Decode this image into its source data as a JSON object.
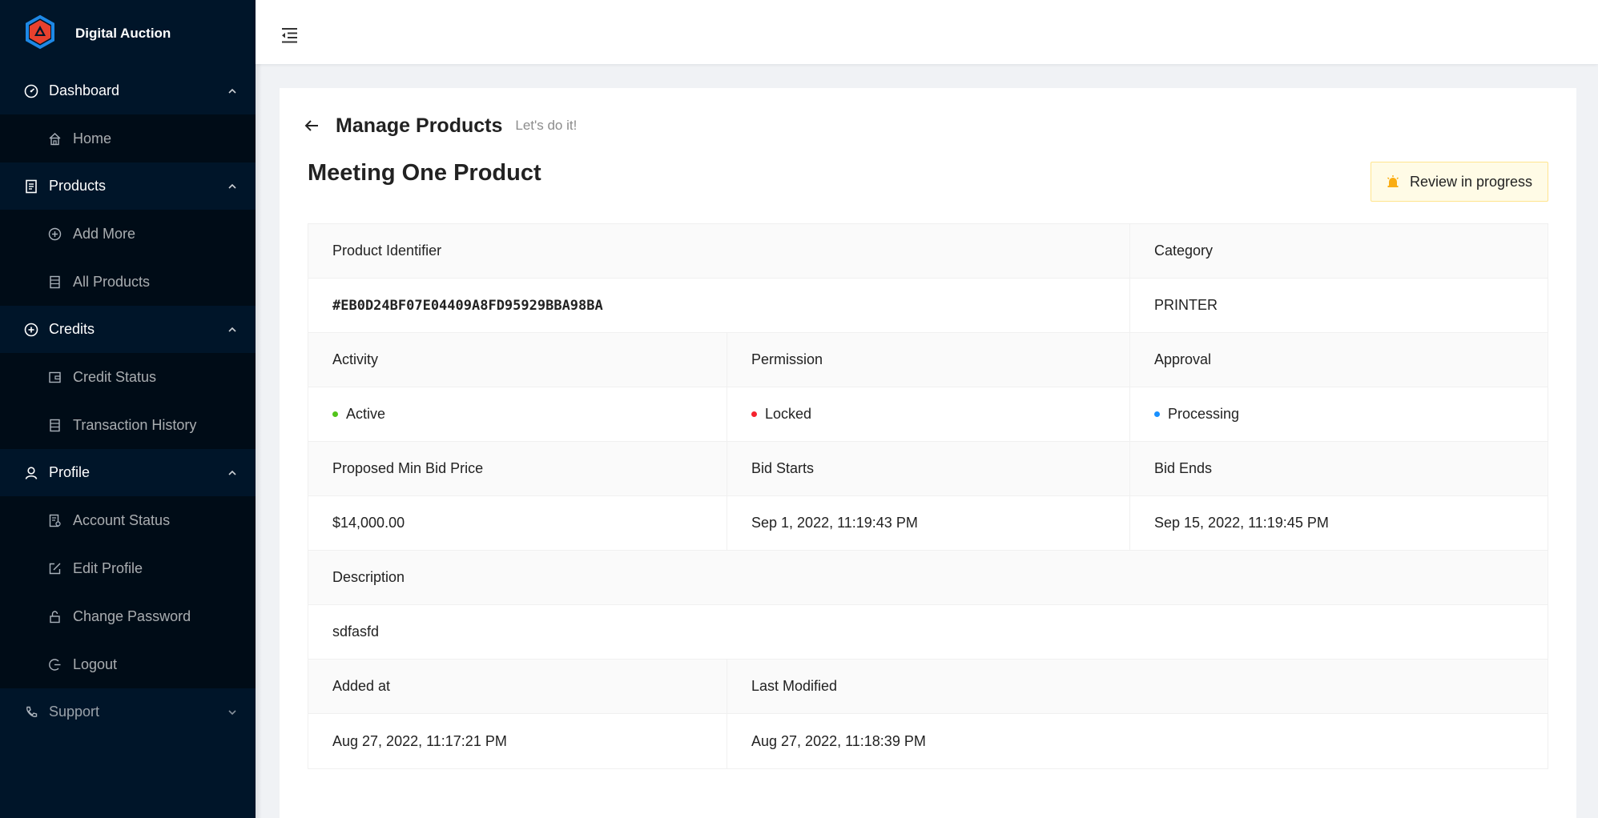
{
  "brand": {
    "name": "Digital Auction"
  },
  "colors": {
    "sidebar_bg": "#001529",
    "submenu_bg": "#000c17",
    "brand_red": "#e8412e",
    "brand_blue": "#1e88e5",
    "active": "#52c41a",
    "locked": "#f5222d",
    "processing": "#1890ff",
    "warning_bg": "#fffbe6",
    "warning_icon": "#faad14"
  },
  "sidebar": {
    "groups": [
      {
        "label": "Dashboard",
        "icon": "dashboard-icon",
        "items": [
          {
            "label": "Home",
            "icon": "home-icon"
          }
        ]
      },
      {
        "label": "Products",
        "icon": "file-text-icon",
        "items": [
          {
            "label": "Add More",
            "icon": "plus-circle-icon"
          },
          {
            "label": "All Products",
            "icon": "database-icon"
          }
        ]
      },
      {
        "label": "Credits",
        "icon": "plus-circle-icon",
        "items": [
          {
            "label": "Credit Status",
            "icon": "wallet-icon"
          },
          {
            "label": "Transaction History",
            "icon": "database-icon"
          }
        ]
      },
      {
        "label": "Profile",
        "icon": "user-icon",
        "items": [
          {
            "label": "Account Status",
            "icon": "solution-icon"
          },
          {
            "label": "Edit Profile",
            "icon": "edit-icon"
          },
          {
            "label": "Change Password",
            "icon": "unlock-icon"
          },
          {
            "label": "Logout",
            "icon": "logout-icon"
          }
        ]
      },
      {
        "label": "Support",
        "icon": "phone-icon",
        "items": []
      }
    ]
  },
  "page": {
    "title": "Manage Products",
    "subtitle": "Let's do it!"
  },
  "product": {
    "name": "Meeting One Product",
    "status_tag": "Review in progress",
    "labels": {
      "identifier": "Product Identifier",
      "category": "Category",
      "activity": "Activity",
      "permission": "Permission",
      "approval": "Approval",
      "min_bid": "Proposed Min Bid Price",
      "bid_starts": "Bid Starts",
      "bid_ends": "Bid Ends",
      "description": "Description",
      "added_at": "Added at",
      "last_modified": "Last Modified"
    },
    "values": {
      "identifier": "#EB0D24BF07E04409A8FD95929BBA98BA",
      "category": "PRINTER",
      "activity": "Active",
      "permission": "Locked",
      "approval": "Processing",
      "min_bid": "$14,000.00",
      "bid_starts": "Sep 1, 2022, 11:19:43 PM",
      "bid_ends": "Sep 15, 2022, 11:19:45 PM",
      "description": "sdfasfd",
      "added_at": "Aug 27, 2022, 11:17:21 PM",
      "last_modified": "Aug 27, 2022, 11:18:39 PM"
    }
  }
}
